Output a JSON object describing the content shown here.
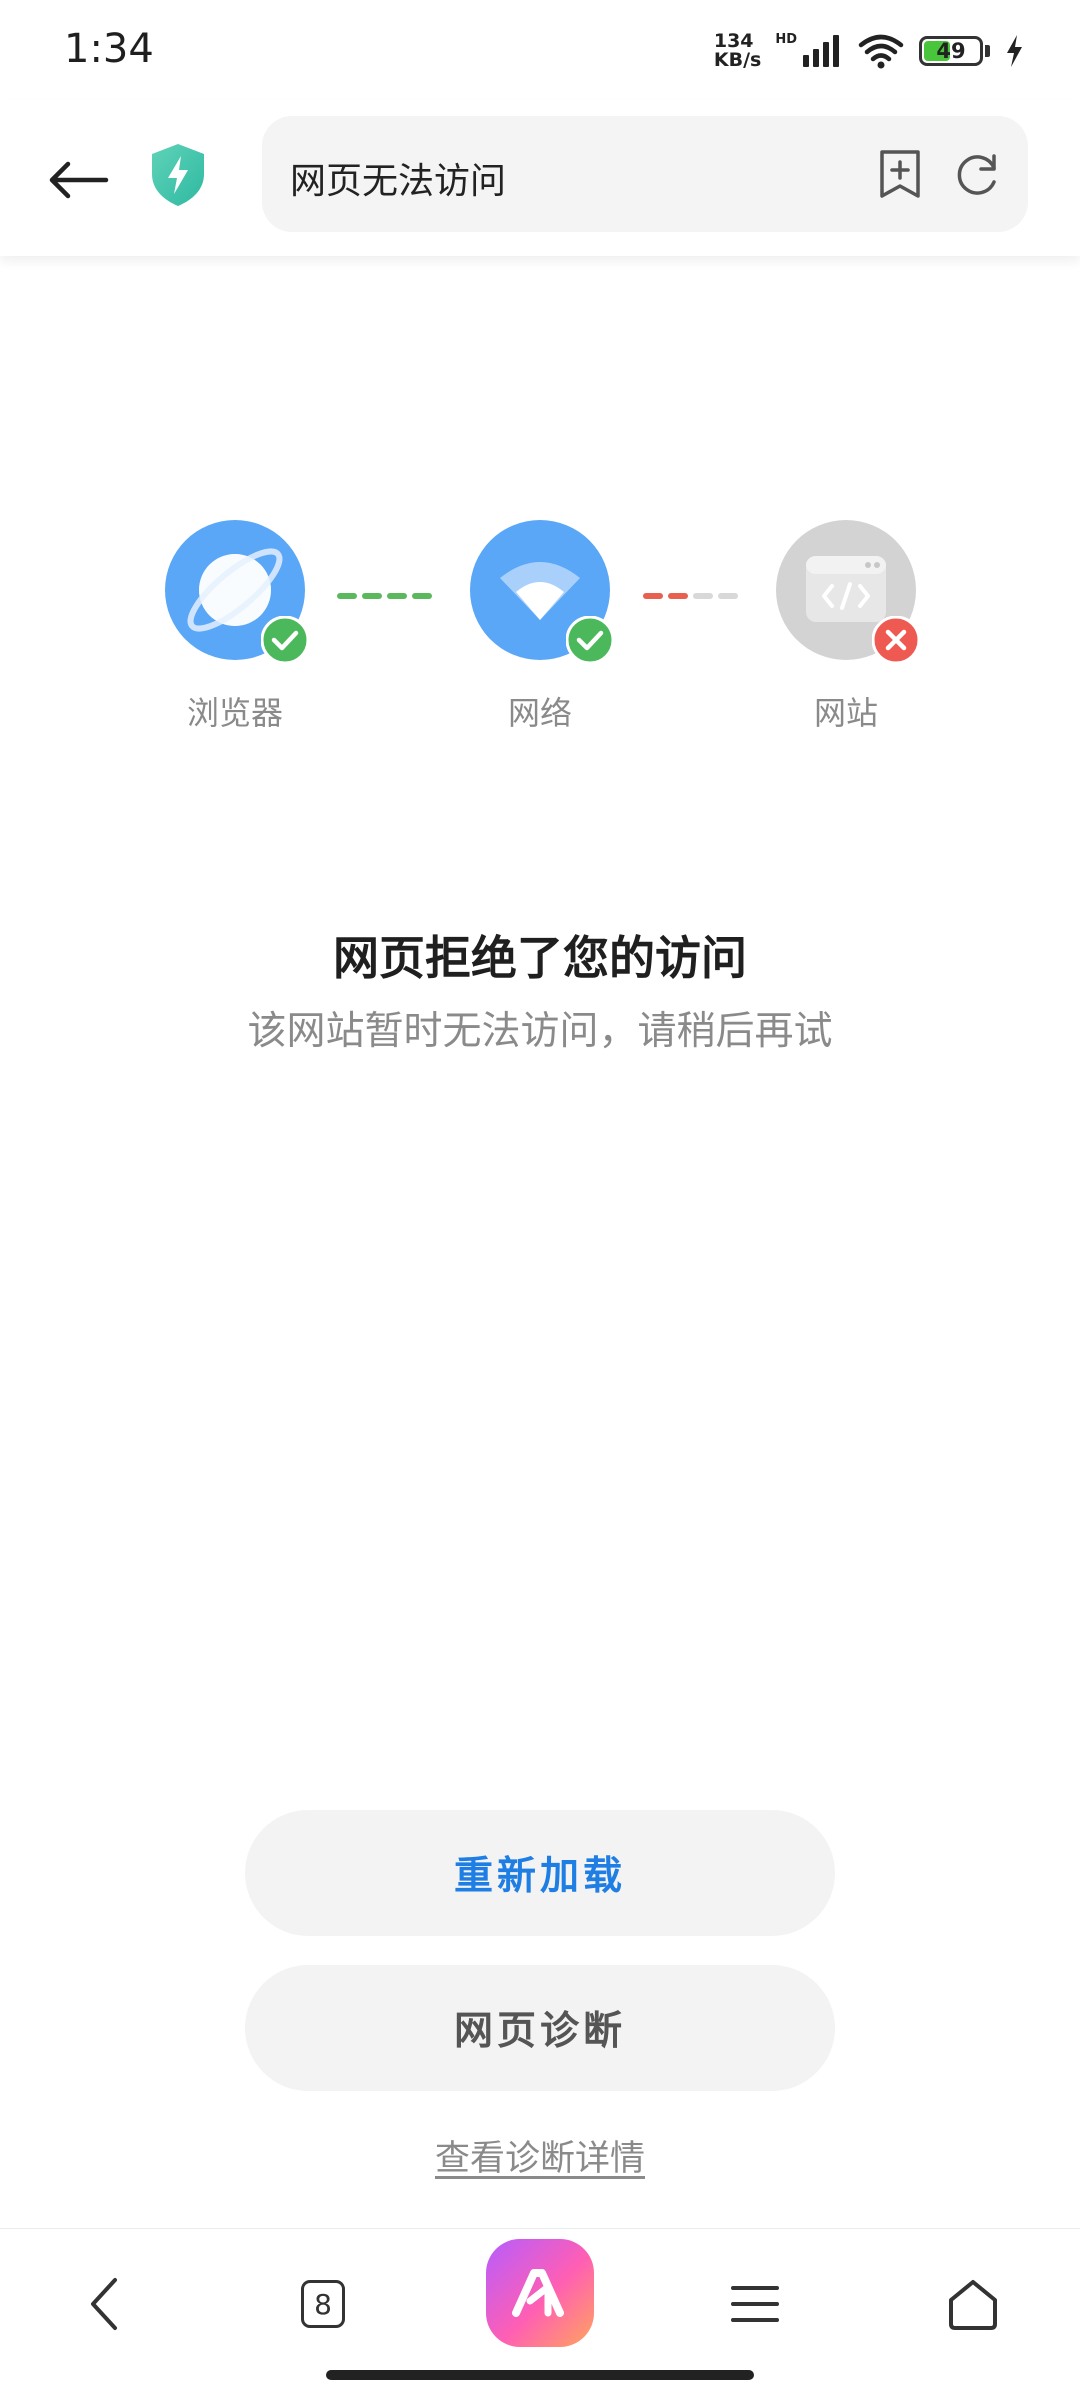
{
  "status_bar": {
    "time": "1:34",
    "net_speed_value": "134",
    "net_speed_unit": "KB/s",
    "hd_label": "HD",
    "battery_level": "49",
    "battery_fraction": 0.49
  },
  "toolbar": {
    "url_text": "网页无法访问"
  },
  "diagnosis": {
    "steps": [
      {
        "label": "浏览器",
        "status": "ok"
      },
      {
        "label": "网络",
        "status": "ok"
      },
      {
        "label": "网站",
        "status": "error"
      }
    ]
  },
  "message": {
    "title": "网页拒绝了您的访问",
    "subtitle": "该网站暂时无法访问，请稍后再试"
  },
  "actions": {
    "reload_label": "重新加载",
    "diagnose_label": "网页诊断",
    "details_link": "查看诊断详情"
  },
  "bottom_nav": {
    "tab_count": "8"
  },
  "colors": {
    "accent_blue": "#1e7ee4",
    "ok_green": "#4cb85c",
    "error_red": "#ee5a52",
    "icon_blue": "#5aa7f7"
  }
}
